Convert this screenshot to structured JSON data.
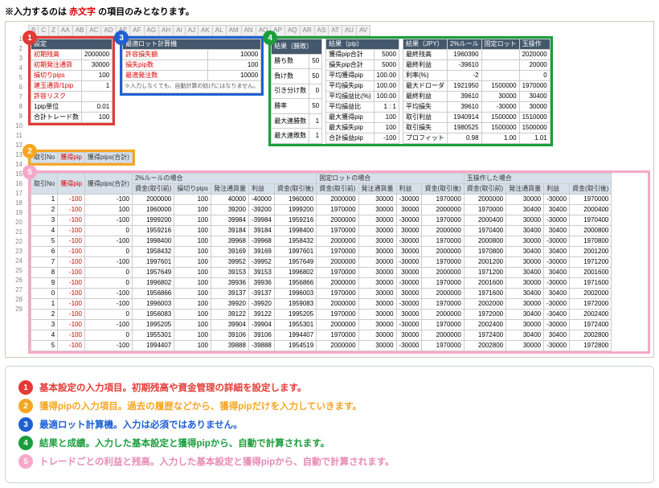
{
  "top_note_pre": "※入力するのは",
  "top_note_red": " 赤文字 ",
  "top_note_post": "の項目のみとなります。",
  "col_headers": [
    "B",
    "C",
    "Z",
    "AA",
    "AB",
    "AC",
    "AD",
    "AE",
    "AF",
    "AG",
    "AH",
    "AI",
    "AJ",
    "AK",
    "AL",
    "AM",
    "AN",
    "AO",
    "AP",
    "AQ",
    "AR",
    "AS",
    "AT",
    "AU",
    "AV"
  ],
  "row_nums": [
    1,
    2,
    3,
    4,
    5,
    6,
    7,
    8,
    9,
    10,
    11,
    12,
    13,
    14,
    15,
    16,
    17,
    18,
    19,
    20,
    21,
    22,
    23,
    24,
    25,
    26,
    27,
    28,
    29
  ],
  "settings_header": "設定",
  "settings_rows": [
    {
      "label": "初期残高",
      "value": "2000000",
      "red": true
    },
    {
      "label": "初期発注通貨",
      "value": "30000",
      "red": true
    },
    {
      "label": "損切りpips",
      "value": "100",
      "red": true
    },
    {
      "label": "建玉通貨/1pip",
      "value": "1",
      "red": true
    },
    {
      "label": "許容リスク",
      "value": "",
      "red": true
    },
    {
      "label": "1pip単位",
      "value": "0.01",
      "red": false
    },
    {
      "label": "合計トレード数",
      "value": "100",
      "red": false
    }
  ],
  "lot_header": "最適ロット計算機",
  "lot_rows": [
    {
      "label": "許容損失額",
      "value": "10000"
    },
    {
      "label": "損失pip数",
      "value": "100"
    },
    {
      "label": "最適発注数",
      "value": "10000"
    }
  ],
  "lot_note": "※入力しなくても、自動計算の妨げにはなりません。",
  "result_kachi_header": "結果（勝敗）",
  "result_kachi": [
    {
      "l": "勝ち数",
      "v": "50"
    },
    {
      "l": "負け数",
      "v": "50"
    },
    {
      "l": "引き分け数",
      "v": "0"
    },
    {
      "l": "勝率",
      "v": "50"
    },
    {
      "l": "最大連勝数",
      "v": "1"
    },
    {
      "l": "最大連敗数",
      "v": "1"
    }
  ],
  "result_pip_header": "結果（pip）",
  "result_pip": [
    {
      "l": "獲得pip合計",
      "v": "5000"
    },
    {
      "l": "損失pip合計",
      "v": "5000"
    },
    {
      "l": "平均獲得pip",
      "v": "100.00"
    },
    {
      "l": "平均損失pip",
      "v": "100.00"
    },
    {
      "l": "平均損益比(%)",
      "v": "100.00"
    },
    {
      "l": "平均損益比",
      "v": "1 : 1"
    },
    {
      "l": "最大獲得pip",
      "v": "100"
    },
    {
      "l": "最大損失pip",
      "v": "100"
    },
    {
      "l": "合計損益pip",
      "v": "-100"
    }
  ],
  "result_jpy_header": "結果（JPY）",
  "result_jpy_sub": [
    "2%ルール",
    "固定ロット",
    "玉操作"
  ],
  "result_jpy": [
    {
      "l": "最終残高",
      "v": [
        "1960390",
        "",
        "2020000"
      ]
    },
    {
      "l": "最終利益",
      "v": [
        "-39610",
        "",
        "20000"
      ]
    },
    {
      "l": "利率(%)",
      "v": [
        "-2",
        "",
        "0"
      ]
    },
    {
      "l": "最大ドローダ",
      "v": [
        "1921950",
        "1500000",
        "1970000"
      ]
    },
    {
      "l": "最終利益",
      "v": [
        "39610",
        "30000",
        "30400"
      ]
    },
    {
      "l": "平均損失",
      "v": [
        "39610",
        "-30000",
        "30000"
      ]
    },
    {
      "l": "取引利益",
      "v": [
        "1940914",
        "1500000",
        "1510000"
      ]
    },
    {
      "l": "取引損失",
      "v": [
        "1980525",
        "1500000",
        "1500000"
      ]
    },
    {
      "l": "プロフィット",
      "v": [
        "0.98",
        "1.00",
        "1.01"
      ]
    }
  ],
  "trades_header": "取引No",
  "trades_ph": "獲得pip",
  "trades_ph2": "獲得pips(合計)",
  "trades_group": [
    "2%ルールの場合",
    "固定ロットの場合",
    "玉操作した場合"
  ],
  "trades_sub": [
    "資金(取引前)",
    "損切りpips",
    "発注通貨量",
    "利益",
    "資金(取引後)",
    "資金(取引前)",
    "発注通貨量",
    "利益",
    "資金(取引後)",
    "資金(取引前)",
    "発注通貨量",
    "利益",
    "資金(取引後)"
  ],
  "trades": [
    [
      1,
      "-100",
      "-100",
      "2000000",
      "100",
      "40000",
      "-40000",
      "1960000",
      "2000000",
      "30000",
      "-30000",
      "1970000",
      "2000000",
      "30000",
      "-30000",
      "1970000"
    ],
    [
      2,
      "-100",
      "100",
      "1960000",
      "100",
      "39200",
      "-39200",
      "1999200",
      "1970000",
      "30000",
      "30000",
      "2000000",
      "1970000",
      "30400",
      "30400",
      "2000400"
    ],
    [
      3,
      "-100",
      "-100",
      "1999200",
      "100",
      "39984",
      "-39984",
      "1959216",
      "2000000",
      "30000",
      "-30000",
      "1970000",
      "2000400",
      "30000",
      "-30000",
      "1970400"
    ],
    [
      4,
      "-100",
      "0",
      "1959216",
      "100",
      "39184",
      "39184",
      "1998400",
      "1970000",
      "30000",
      "30000",
      "2000000",
      "1970400",
      "30400",
      "30400",
      "2000800"
    ],
    [
      5,
      "-100",
      "-100",
      "1998400",
      "100",
      "39968",
      "-39968",
      "1958432",
      "2000000",
      "30000",
      "-30000",
      "1970000",
      "2000800",
      "30000",
      "-30000",
      "1970800"
    ],
    [
      6,
      "-100",
      "0",
      "1958432",
      "100",
      "39169",
      "39169",
      "1997601",
      "1970000",
      "30000",
      "30000",
      "2000000",
      "1970800",
      "30400",
      "30400",
      "2001200"
    ],
    [
      7,
      "-100",
      "-100",
      "1997601",
      "100",
      "39952",
      "-39952",
      "1957649",
      "2000000",
      "30000",
      "-30000",
      "1970000",
      "2001200",
      "30000",
      "-30000",
      "1971200"
    ],
    [
      8,
      "-100",
      "0",
      "1957649",
      "100",
      "39153",
      "39153",
      "1996802",
      "1970000",
      "30000",
      "30000",
      "2000000",
      "1971200",
      "30400",
      "30400",
      "2001600"
    ],
    [
      9,
      "-100",
      "0",
      "1996802",
      "100",
      "39936",
      "39936",
      "1956866",
      "2000000",
      "30000",
      "-30000",
      "1970000",
      "2001600",
      "30000",
      "-30000",
      "1971600"
    ],
    [
      0,
      "-100",
      "-100",
      "1956866",
      "100",
      "39137",
      "-39137",
      "1996003",
      "1970000",
      "30000",
      "30000",
      "2000000",
      "1971600",
      "30400",
      "30400",
      "2002000"
    ],
    [
      1,
      "-100",
      "-100",
      "1996003",
      "100",
      "39920",
      "-39920",
      "1959083",
      "2000000",
      "30000",
      "-30000",
      "1970000",
      "2002000",
      "30000",
      "-30000",
      "1972000"
    ],
    [
      2,
      "-100",
      "0",
      "1956083",
      "100",
      "39122",
      "39122",
      "1995205",
      "1970000",
      "30000",
      "30000",
      "2000000",
      "1972000",
      "30400",
      "-30400",
      "2002400"
    ],
    [
      3,
      "-100",
      "-100",
      "1995205",
      "100",
      "39904",
      "-39904",
      "1955301",
      "2000000",
      "30000",
      "-30000",
      "1970000",
      "2002400",
      "30000",
      "-30000",
      "1972400"
    ],
    [
      4,
      "-100",
      "0",
      "1955301",
      "100",
      "39106",
      "39106",
      "1994407",
      "1970000",
      "30000",
      "30000",
      "2000000",
      "1972400",
      "30400",
      "30400",
      "2002800"
    ],
    [
      5,
      "-100",
      "-100",
      "1994407",
      "100",
      "39888",
      "-39888",
      "1954519",
      "2000000",
      "30000",
      "-30000",
      "1970000",
      "2002800",
      "30000",
      "-30000",
      "1972800"
    ]
  ],
  "legend": [
    {
      "n": "1",
      "text": "基本設定の入力項目。初期残高や資金管理の詳細を設定します。"
    },
    {
      "n": "2",
      "text": "獲得pipの入力項目。過去の履歴などから、獲得pipだけを入力していきます。"
    },
    {
      "n": "3",
      "text": "最適ロット計算機。入力は必須ではありません。"
    },
    {
      "n": "4",
      "text": "結果と成績。入力した基本設定と獲得pipから、自動で計算されます。"
    },
    {
      "n": "5",
      "text": "トレードごとの利益と残高。入力した基本設定と獲得pipから、自動で計算されます。"
    }
  ]
}
